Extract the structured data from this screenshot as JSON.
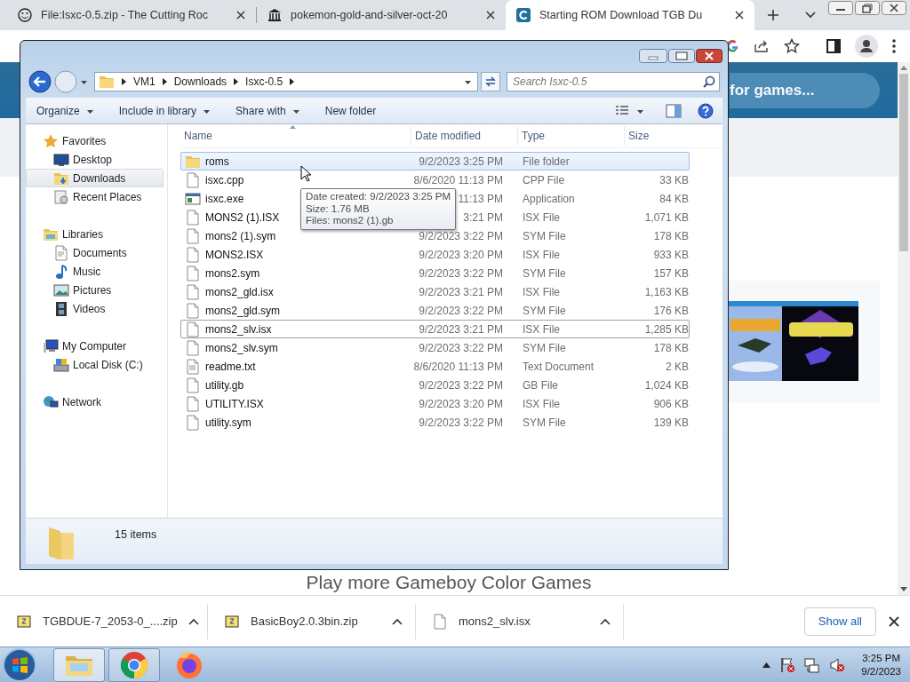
{
  "browser": {
    "tabs": [
      {
        "title": "File:Isxc-0.5.zip - The Cutting Roc",
        "kind": "smiley",
        "selected": false
      },
      {
        "title": "pokemon-gold-and-silver-oct-20",
        "kind": "museum",
        "selected": false
      },
      {
        "title": "Starting ROM Download TGB Du",
        "kind": "site",
        "selected": true
      }
    ]
  },
  "page": {
    "search_placeholder": "for games...",
    "heading": "Play more Gameboy Color Games"
  },
  "explorer": {
    "breadcrumb": [
      "VM1",
      "Downloads",
      "Isxc-0.5"
    ],
    "search": {
      "placeholder": "Search Isxc-0.5"
    },
    "toolbar": [
      {
        "label": "Organize",
        "menu": true
      },
      {
        "label": "Include in library",
        "menu": true
      },
      {
        "label": "Share with",
        "menu": true
      },
      {
        "label": "New folder",
        "menu": false
      }
    ],
    "nav": [
      {
        "label": "Favorites",
        "kind": "star",
        "selected": false,
        "children": [
          {
            "label": "Desktop",
            "kind": "desktop",
            "selected": false
          },
          {
            "label": "Downloads",
            "kind": "downloads",
            "selected": true
          },
          {
            "label": "Recent Places",
            "kind": "recent",
            "selected": false
          }
        ]
      },
      {
        "label": "Libraries",
        "kind": "libraries",
        "selected": false,
        "children": [
          {
            "label": "Documents",
            "kind": "documents",
            "selected": false
          },
          {
            "label": "Music",
            "kind": "music",
            "selected": false
          },
          {
            "label": "Pictures",
            "kind": "pictures",
            "selected": false
          },
          {
            "label": "Videos",
            "kind": "videos",
            "selected": false
          }
        ]
      },
      {
        "label": "My Computer",
        "kind": "computer",
        "selected": false,
        "children": [
          {
            "label": "Local Disk (C:)",
            "kind": "disk",
            "selected": false
          }
        ]
      },
      {
        "label": "Network",
        "kind": "network",
        "selected": false
      }
    ],
    "columns": [
      "Name",
      "Date modified",
      "Type",
      "Size"
    ],
    "rows": [
      {
        "name": "roms",
        "date": "9/2/2023 3:25 PM",
        "type": "File folder",
        "size": "",
        "kind": "folder",
        "selected": true,
        "focused": false
      },
      {
        "name": "isxc.cpp",
        "date": "8/6/2020 11:13 PM",
        "type": "CPP File",
        "size": "33 KB",
        "kind": "file",
        "selected": false,
        "focused": false
      },
      {
        "name": "isxc.exe",
        "date": "11:13 PM",
        "type": "Application",
        "size": "84 KB",
        "kind": "exe",
        "selected": false,
        "focused": false
      },
      {
        "name": "MONS2 (1).ISX",
        "date": "3:21 PM",
        "type": "ISX File",
        "size": "1,071 KB",
        "kind": "file",
        "selected": false,
        "focused": false
      },
      {
        "name": "mons2 (1).sym",
        "date": "9/2/2023 3:22 PM",
        "type": "SYM File",
        "size": "178 KB",
        "kind": "file",
        "selected": false,
        "focused": false
      },
      {
        "name": "MONS2.ISX",
        "date": "9/2/2023 3:20 PM",
        "type": "ISX File",
        "size": "933 KB",
        "kind": "file",
        "selected": false,
        "focused": false
      },
      {
        "name": "mons2.sym",
        "date": "9/2/2023 3:22 PM",
        "type": "SYM File",
        "size": "157 KB",
        "kind": "file",
        "selected": false,
        "focused": false
      },
      {
        "name": "mons2_gld.isx",
        "date": "9/2/2023 3:21 PM",
        "type": "ISX File",
        "size": "1,163 KB",
        "kind": "file",
        "selected": false,
        "focused": false
      },
      {
        "name": "mons2_gld.sym",
        "date": "9/2/2023 3:22 PM",
        "type": "SYM File",
        "size": "176 KB",
        "kind": "file",
        "selected": false,
        "focused": false
      },
      {
        "name": "mons2_slv.isx",
        "date": "9/2/2023 3:21 PM",
        "type": "ISX File",
        "size": "1,285 KB",
        "kind": "file",
        "selected": false,
        "focused": true
      },
      {
        "name": "mons2_slv.sym",
        "date": "9/2/2023 3:22 PM",
        "type": "SYM File",
        "size": "178 KB",
        "kind": "file",
        "selected": false,
        "focused": false
      },
      {
        "name": "readme.txt",
        "date": "8/6/2020 11:13 PM",
        "type": "Text Document",
        "size": "2 KB",
        "kind": "text",
        "selected": false,
        "focused": false
      },
      {
        "name": "utility.gb",
        "date": "9/2/2023 3:22 PM",
        "type": "GB File",
        "size": "1,024 KB",
        "kind": "file",
        "selected": false,
        "focused": false
      },
      {
        "name": "UTILITY.ISX",
        "date": "9/2/2023 3:20 PM",
        "type": "ISX File",
        "size": "906 KB",
        "kind": "file",
        "selected": false,
        "focused": false
      },
      {
        "name": "utility.sym",
        "date": "9/2/2023 3:22 PM",
        "type": "SYM File",
        "size": "139 KB",
        "kind": "file",
        "selected": false,
        "focused": false
      }
    ],
    "tooltip": [
      "Date created: 9/2/2023 3:25 PM",
      "Size: 1.76 MB",
      "Files: mons2 (1).gb"
    ],
    "status": "15 items"
  },
  "downloads": {
    "items": [
      {
        "name": "TGBDUE-7_2053-0_....zip",
        "kind": "zip"
      },
      {
        "name": "BasicBoy2.0.3bin.zip",
        "kind": "zip"
      },
      {
        "name": "mons2_slv.isx",
        "kind": "file"
      }
    ],
    "show_all": "Show all"
  },
  "taskbar": {
    "apps": [
      {
        "kind": "explorer",
        "selected": true,
        "running": true
      },
      {
        "kind": "chrome",
        "selected": false,
        "running": true
      },
      {
        "kind": "firefox",
        "selected": false,
        "running": false
      }
    ],
    "time": "3:25 PM",
    "date": "9/2/2023"
  }
}
